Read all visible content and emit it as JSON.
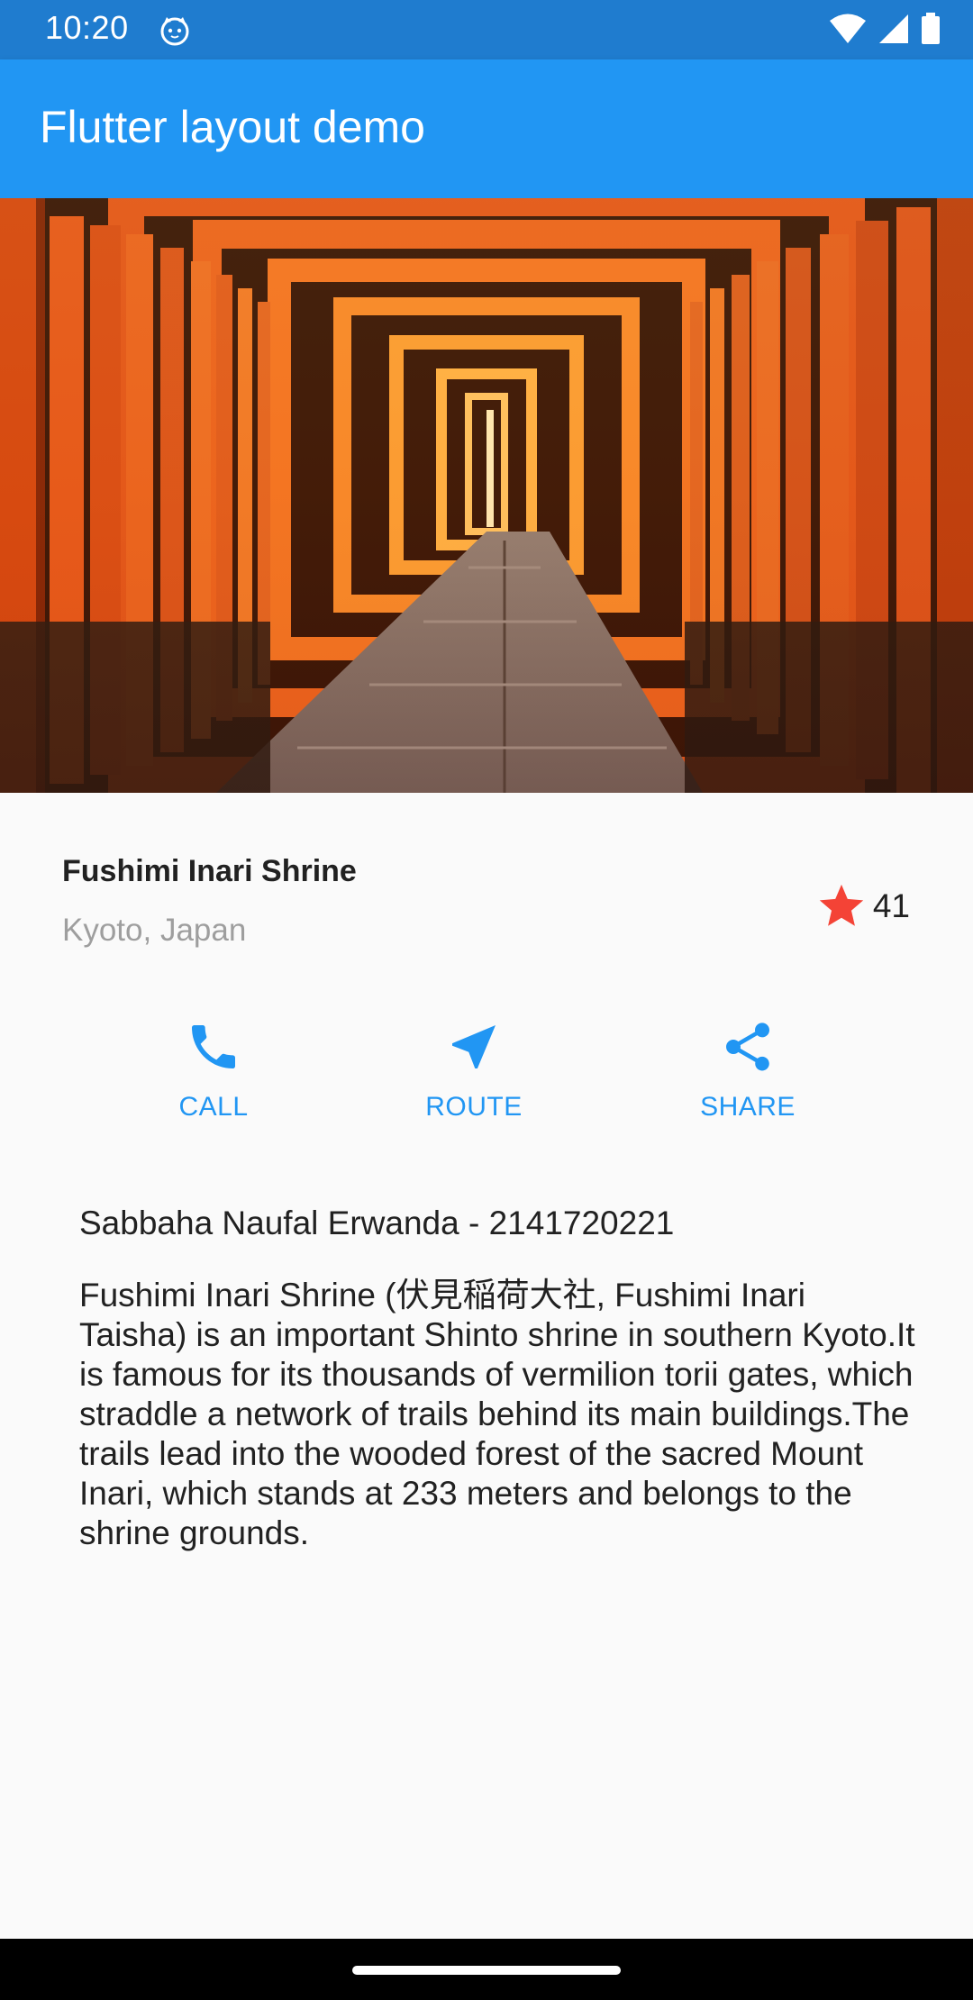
{
  "status_bar": {
    "time": "10:20",
    "app_icon": "cat-face-icon",
    "icons": [
      "wifi-icon",
      "signal-icon",
      "battery-icon"
    ]
  },
  "app_bar": {
    "title": "Flutter layout demo",
    "color": "#2196F3"
  },
  "hero": {
    "image": "torii-gates-tunnel-photo"
  },
  "place": {
    "name": "Fushimi Inari Shrine",
    "location": "Kyoto, Japan",
    "rating_icon": "star-icon",
    "rating_count": "41",
    "star_color": "#F44336"
  },
  "actions": [
    {
      "label": "CALL",
      "icon": "phone-icon"
    },
    {
      "label": "ROUTE",
      "icon": "navigation-icon"
    },
    {
      "label": "SHARE",
      "icon": "share-icon"
    }
  ],
  "content": {
    "student": "Sabbaha Naufal Erwanda - 2141720221",
    "description": "Fushimi Inari Shrine (伏見稲荷大社, Fushimi Inari Taisha) is an important Shinto shrine in southern Kyoto.It is famous for its thousands of vermilion torii gates, which straddle a network of trails behind its main buildings.The trails lead into the wooded forest of the sacred Mount Inari, which stands at 233 meters and belongs to the shrine grounds."
  },
  "colors": {
    "accent": "#2196F3",
    "status_bar": "#1F7CCF",
    "background": "#FAFAFA"
  }
}
